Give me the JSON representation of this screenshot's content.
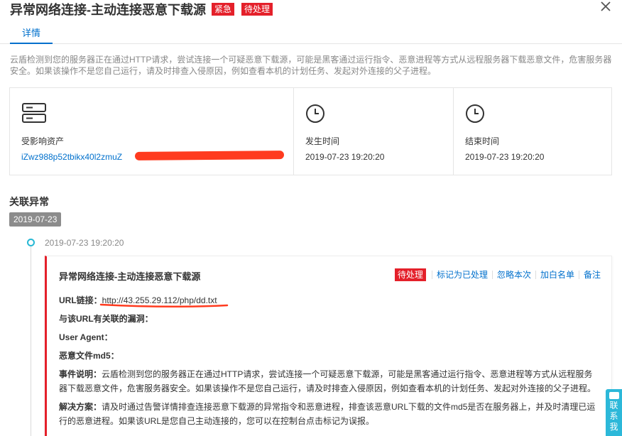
{
  "header": {
    "title": "异常网络连接-主动连接恶意下载源",
    "badge_urgent": "紧急",
    "badge_pending": "待处理"
  },
  "tabs": [
    {
      "label": "详情"
    }
  ],
  "description": "云盾检测到您的服务器正在通过HTTP请求，尝试连接一个可疑恶意下载源，可能是黑客通过运行指令、恶意进程等方式从远程服务器下载恶意文件，危害服务器安全。如果该操作不是您自己运行，请及时排查入侵原因，例如查看本机的计划任务、发起对外连接的父子进程。",
  "cards": {
    "asset": {
      "label": "受影响资产",
      "value": "iZwz988p52tbikx40l2zmuZ"
    },
    "start": {
      "label": "发生时间",
      "value": "2019-07-23 19:20:20"
    },
    "end": {
      "label": "结束时间",
      "value": "2019-07-23 19:20:20"
    }
  },
  "related": {
    "title": "关联异常",
    "date": "2019-07-23",
    "timeline_time": "2019-07-23 19:20:20"
  },
  "event": {
    "title": "异常网络连接-主动连接恶意下载源",
    "status": "待处理",
    "actions": [
      "标记为已处理",
      "忽略本次",
      "加白名单",
      "备注"
    ],
    "url_label": "URL链接：",
    "url_value": "http://43.255.29.112/php/dd.txt",
    "vuln_label": "与该URL有关联的漏洞：",
    "ua_label": "User Agent：",
    "md5_label": "恶意文件md5：",
    "desc_label": "事件说明：",
    "desc_text": "云盾检测到您的服务器正在通过HTTP请求，尝试连接一个可疑恶意下载源，可能是黑客通过运行指令、恶意进程等方式从远程服务器下载恶意文件，危害服务器安全。如果该操作不是您自己运行，请及时排查入侵原因，例如查看本机的计划任务、发起对外连接的父子进程。",
    "solution_label": "解决方案：",
    "solution_text": "请及时通过告警详情排查连接恶意下载源的异常指令和恶意进程，排查该恶意URL下载的文件md5是否在服务器上，并及时清理已运行的恶意进程。如果该URL是您自己主动连接的，您可以在控制台点击标记为误报。"
  },
  "floater": {
    "line1": "联",
    "line2": "系",
    "line3": "我"
  },
  "colors": {
    "accent": "#0070cc",
    "danger": "#e4202a",
    "teal": "#2cb8d9"
  },
  "icons": {
    "close": "close-icon",
    "asset": "server-icon",
    "time": "clock-icon"
  }
}
